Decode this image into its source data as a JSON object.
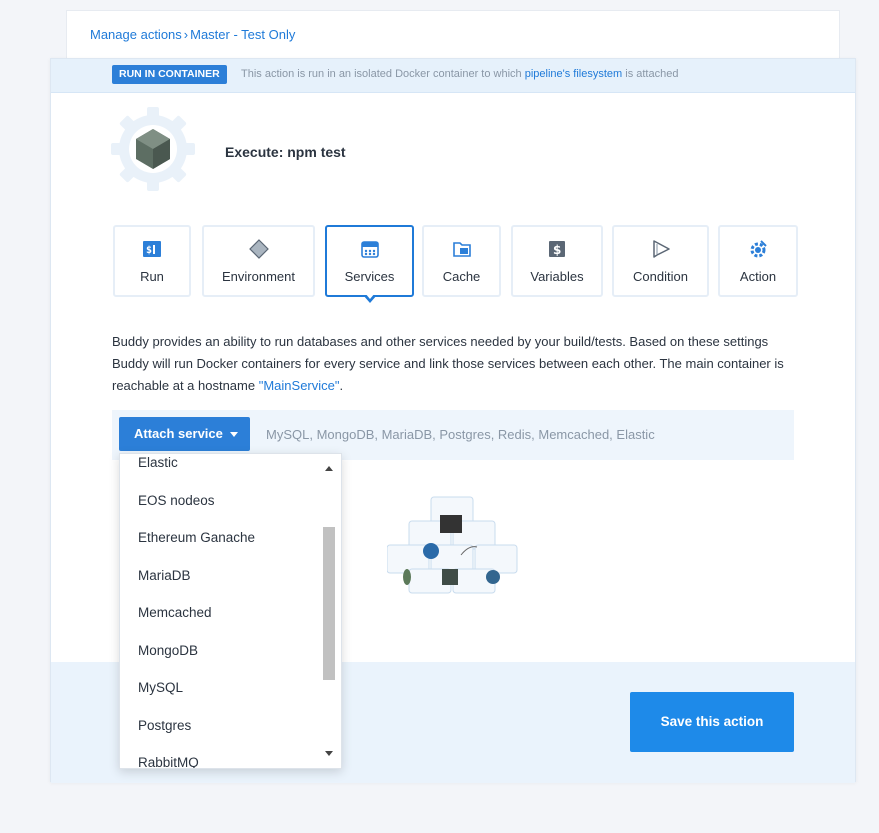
{
  "breadcrumb": {
    "items": [
      "Manage actions",
      "Master - Test Only"
    ],
    "separator": "›"
  },
  "container_notice": {
    "badge": "RUN IN CONTAINER",
    "text_before": "This action is run in an isolated Docker container to which",
    "link": "pipeline's filesystem",
    "text_after": "is attached"
  },
  "action": {
    "title": "Execute: npm test"
  },
  "tabs": [
    {
      "label": "Run",
      "icon": "terminal-icon",
      "active": false
    },
    {
      "label": "Environment",
      "icon": "diamond-icon",
      "active": false
    },
    {
      "label": "Services",
      "icon": "services-icon",
      "active": true
    },
    {
      "label": "Cache",
      "icon": "folder-icon",
      "active": false
    },
    {
      "label": "Variables",
      "icon": "dollar-icon",
      "active": false
    },
    {
      "label": "Condition",
      "icon": "play-icon",
      "active": false
    },
    {
      "label": "Action",
      "icon": "gear-icon",
      "active": false
    }
  ],
  "description": {
    "text": "Buddy provides an ability to run databases and other services needed by your build/tests. Based on these settings Buddy will run Docker containers for every service and link those services between each other. The main container is reachable at a hostname",
    "link": "\"MainService\"",
    "end": "."
  },
  "attach": {
    "button_label": "Attach service",
    "hint": "MySQL, MongoDB, MariaDB, Postgres, Redis, Memcached, Elastic"
  },
  "dropdown": {
    "options": [
      "Elastic",
      "EOS nodeos",
      "Ethereum Ganache",
      "MariaDB",
      "Memcached",
      "MongoDB",
      "MySQL",
      "Postgres",
      "RabbitMQ"
    ]
  },
  "footer": {
    "save_label": "Save this action"
  },
  "colors": {
    "accent": "#1f7ad8",
    "button": "#2c7fd8",
    "save_button": "#1e8ae9"
  }
}
